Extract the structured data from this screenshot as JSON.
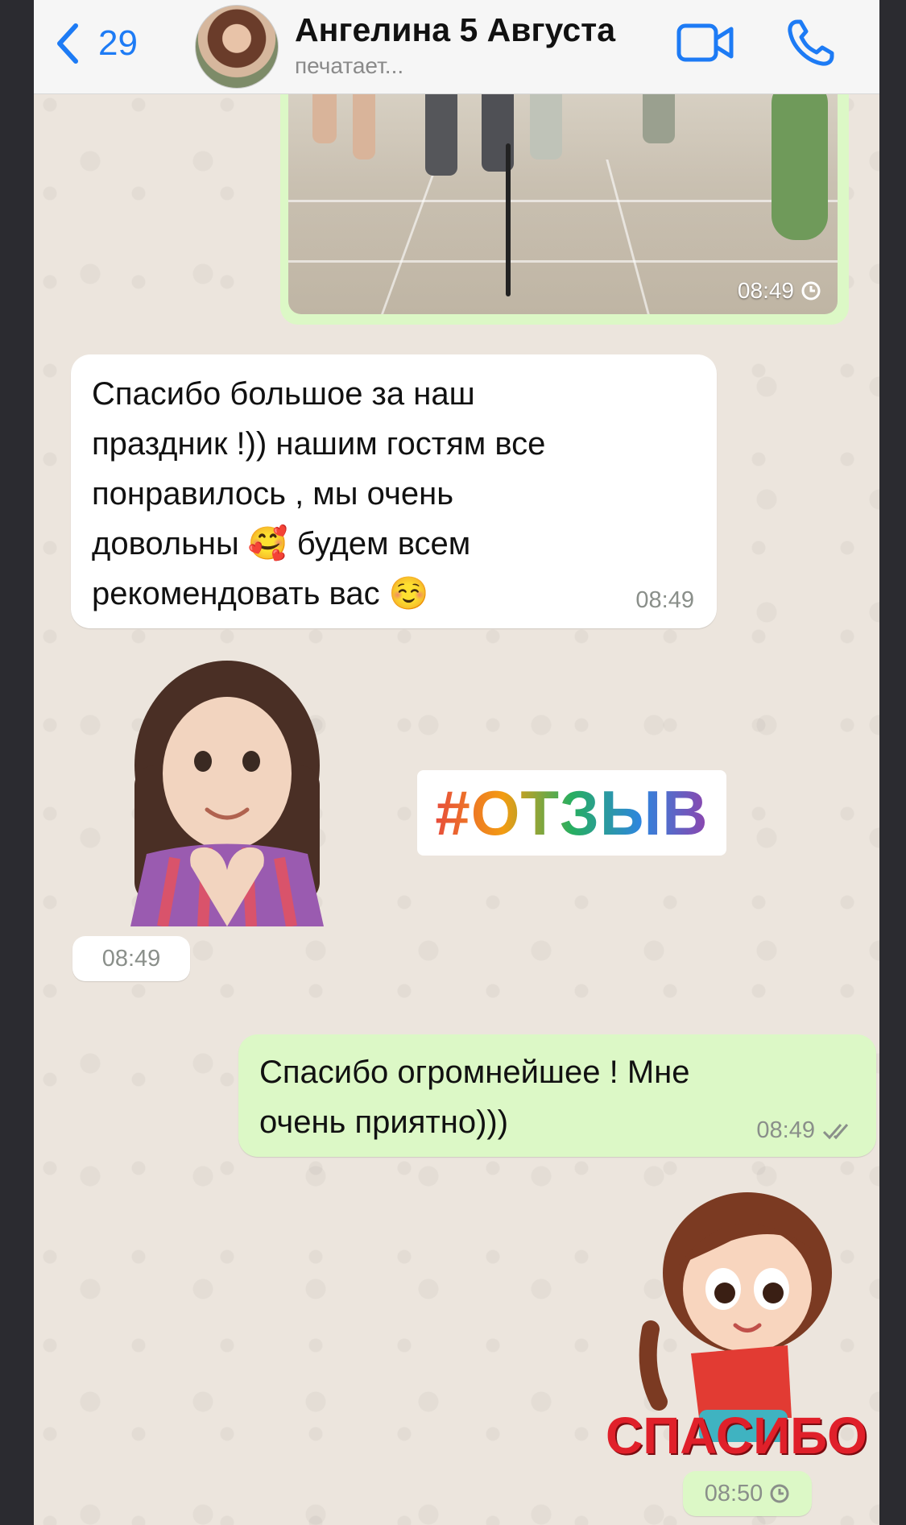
{
  "header": {
    "back_count": "29",
    "contact_name": "Ангелина 5 Августа",
    "status": "печатает..."
  },
  "messages": {
    "media_time": "08:49",
    "incoming_text": "Спасибо большое за наш\nпраздник !)) нашим гостям все\nпонравилось , мы очень\nдовольны 🥰 будем всем\nрекомендовать вас ☺️",
    "incoming_time": "08:49",
    "hashtag": "#ОТЗЫВ",
    "sticker_time": "08:49",
    "outgoing_text": "Спасибо огромнейшее ! Мне\nочень приятно)))",
    "outgoing_time": "08:49",
    "sticker2_text": "СПАСИБО",
    "sticker2_time": "08:50"
  },
  "colors": {
    "accent": "#1d7bf5",
    "outgoing_bubble": "#dcf8c6",
    "incoming_bubble": "#ffffff",
    "chat_bg": "#ece5dd"
  }
}
